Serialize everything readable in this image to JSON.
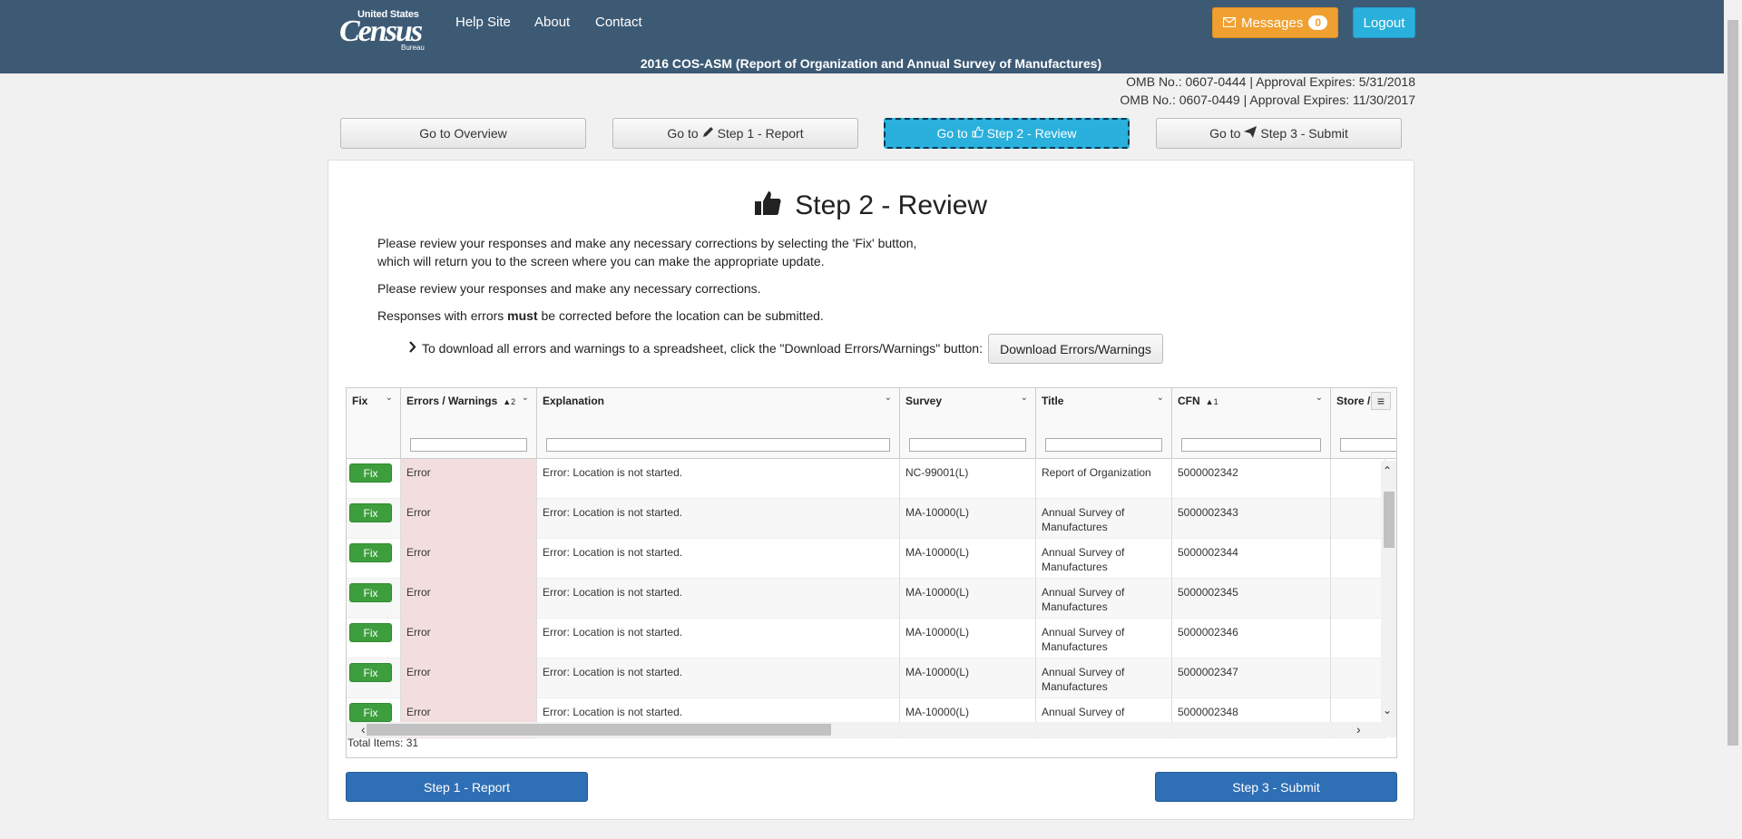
{
  "header": {
    "logo": {
      "line1": "United States",
      "line2": "Census",
      "line3": "Bureau"
    },
    "nav": [
      "Help Site",
      "About",
      "Contact"
    ],
    "messages_label": "Messages",
    "messages_count": "0",
    "logout_label": "Logout",
    "survey_title": "2016 COS-ASM (Report of Organization and Annual Survey of Manufactures)"
  },
  "omb": [
    "OMB No.: 0607-0444  |  Approval Expires: 5/31/2018",
    "OMB No.: 0607-0449  |  Approval Expires: 11/30/2017"
  ],
  "steps": {
    "overview": "Go to Overview",
    "step1_prefix": "Go to",
    "step1": "Step 1 - Report",
    "step2_prefix": "Go to",
    "step2": "Step 2 - Review",
    "step3_prefix": "Go to",
    "step3": "Step 3 - Submit"
  },
  "page": {
    "heading": "Step 2 - Review",
    "para1_line1": "Please review your responses and make any necessary corrections by selecting the 'Fix' button,",
    "para1_line2": "which will return you to the screen where you can make the appropriate update.",
    "para2": "Please review your responses and make any necessary corrections.",
    "para3_before": "Responses with errors ",
    "para3_bold": "must",
    "para3_after": " be corrected before the location can be submitted.",
    "download_text": "To download all errors and warnings to a spreadsheet, click the \"Download Errors/Warnings\" button:",
    "download_button": "Download Errors/Warnings"
  },
  "grid": {
    "columns": {
      "fix": "Fix",
      "errors": "Errors / Warnings",
      "errors_sort": "▲2",
      "explanation": "Explanation",
      "survey": "Survey",
      "title": "Title",
      "cfn": "CFN",
      "cfn_sort": "▲1",
      "store": "Store / P"
    },
    "rows": [
      {
        "fix": "Fix",
        "status": "Error",
        "explanation": "Error: Location is not started.",
        "survey": "NC-99001(L)",
        "title": "Report of Organization",
        "cfn": "5000002342"
      },
      {
        "fix": "Fix",
        "status": "Error",
        "explanation": "Error: Location is not started.",
        "survey": "MA-10000(L)",
        "title": "Annual Survey of Manufactures",
        "cfn": "5000002343"
      },
      {
        "fix": "Fix",
        "status": "Error",
        "explanation": "Error: Location is not started.",
        "survey": "MA-10000(L)",
        "title": "Annual Survey of Manufactures",
        "cfn": "5000002344"
      },
      {
        "fix": "Fix",
        "status": "Error",
        "explanation": "Error: Location is not started.",
        "survey": "MA-10000(L)",
        "title": "Annual Survey of Manufactures",
        "cfn": "5000002345"
      },
      {
        "fix": "Fix",
        "status": "Error",
        "explanation": "Error: Location is not started.",
        "survey": "MA-10000(L)",
        "title": "Annual Survey of Manufactures",
        "cfn": "5000002346"
      },
      {
        "fix": "Fix",
        "status": "Error",
        "explanation": "Error: Location is not started.",
        "survey": "MA-10000(L)",
        "title": "Annual Survey of Manufactures",
        "cfn": "5000002347"
      },
      {
        "fix": "Fix",
        "status": "Error",
        "explanation": "Error: Location is not started.",
        "survey": "MA-10000(L)",
        "title": "Annual Survey of",
        "cfn": "5000002348"
      }
    ],
    "total_items": "Total Items: 31"
  },
  "footer_buttons": {
    "prev": "Step 1 - Report",
    "next": "Step 3 - Submit"
  },
  "colors": {
    "header": "#3d5a75",
    "messages": "#f0a030",
    "logout": "#29b0dc",
    "fix": "#3d9e3d",
    "nav_button": "#2f6fb5",
    "error_cell": "#f2dede"
  }
}
